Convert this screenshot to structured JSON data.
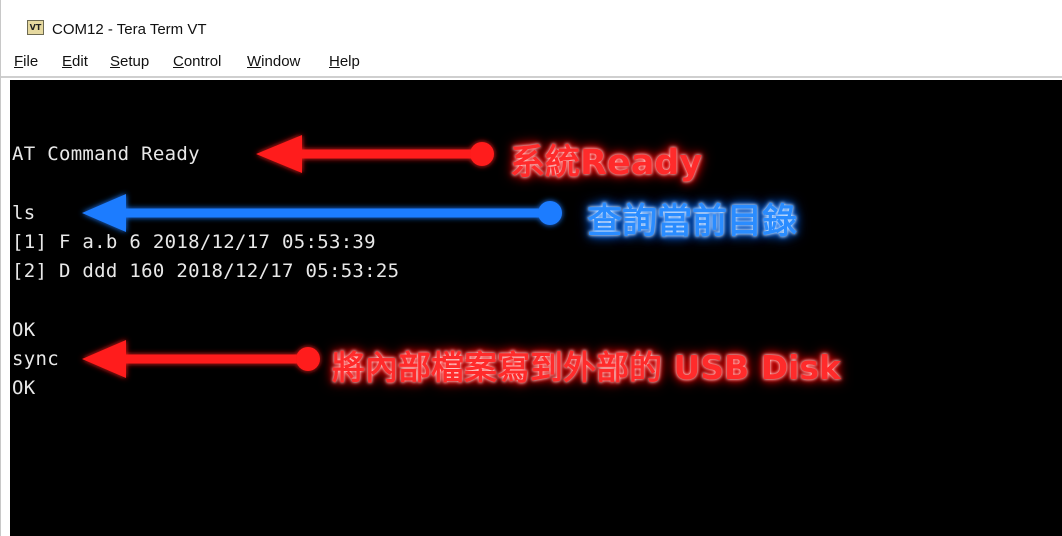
{
  "window": {
    "title": "COM12 - Tera Term VT",
    "icon_label": "VT"
  },
  "menu": {
    "items": [
      {
        "accel": "F",
        "rest": "ile"
      },
      {
        "accel": "E",
        "rest": "dit"
      },
      {
        "accel": "S",
        "rest": "etup"
      },
      {
        "accel": "C",
        "rest": "ontrol"
      },
      {
        "accel": "W",
        "rest": "indow"
      },
      {
        "accel": "H",
        "rest": "elp"
      }
    ]
  },
  "terminal": {
    "lines": [
      "AT Command Ready",
      "ls",
      "[1] F a.b 6 2018/12/17 05:53:39",
      "[2] D ddd 160 2018/12/17 05:53:25",
      "OK",
      "sync",
      "OK"
    ]
  },
  "annotations": {
    "ready": "系統Ready",
    "ls": "查詢當前目錄",
    "sync": "將內部檔案寫到外部的 USB Disk"
  },
  "colors": {
    "terminal_bg": "#000000",
    "terminal_text": "#e8e8e8",
    "annotation_red": "#ff1a1a",
    "annotation_blue": "#1e7bff"
  }
}
